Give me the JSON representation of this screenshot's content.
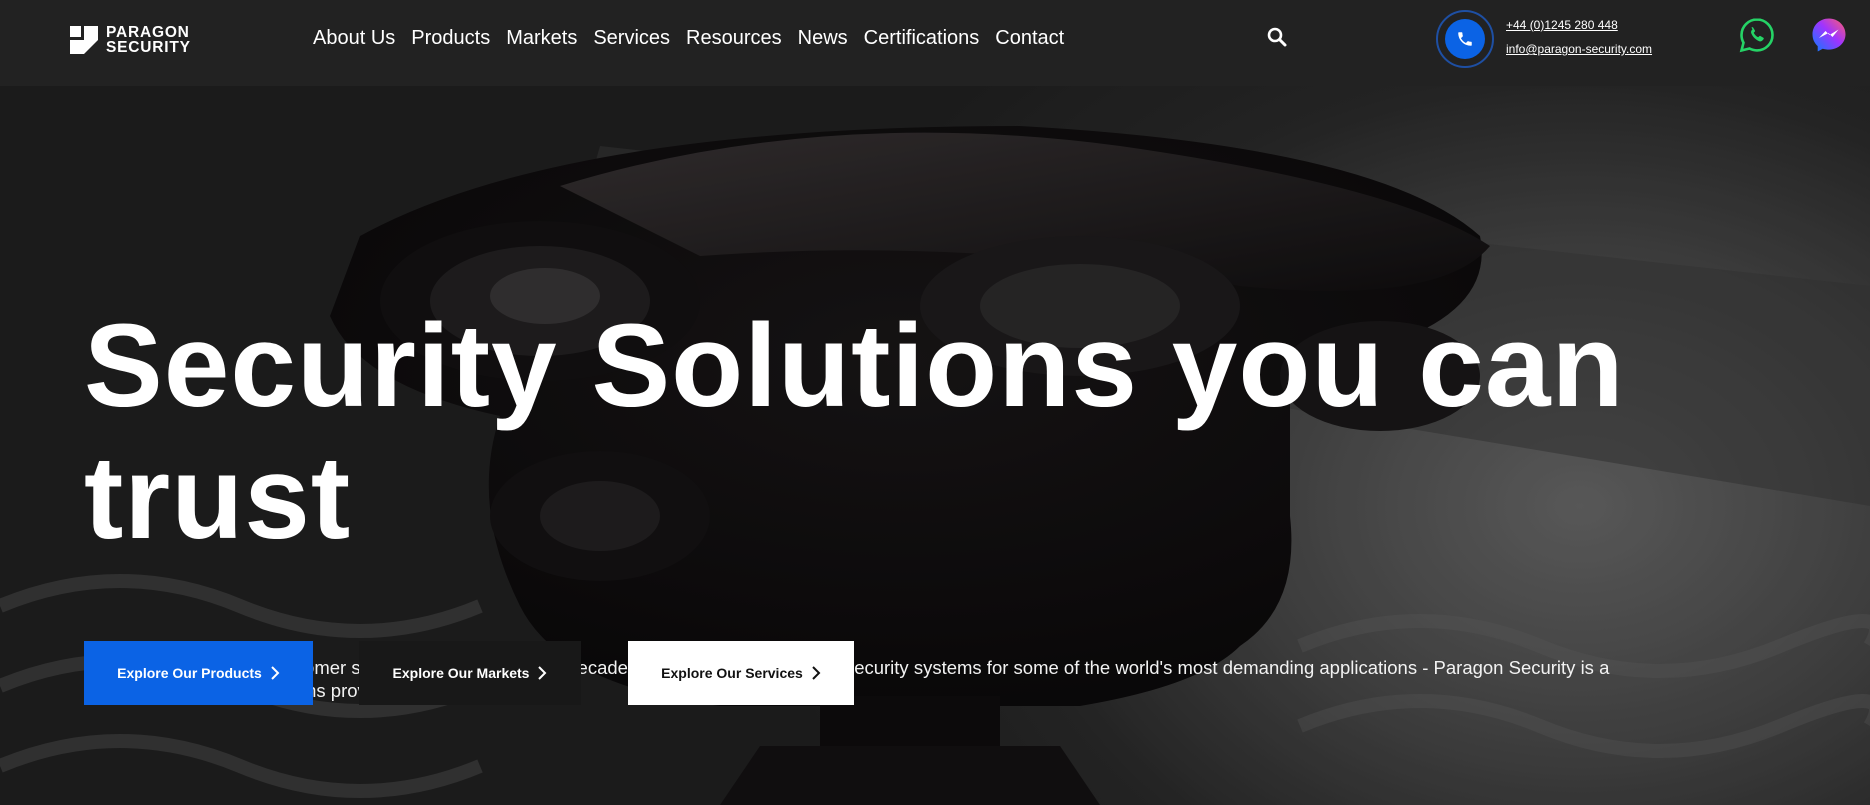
{
  "brand": {
    "line1": "PARAGON",
    "line2": "SECURITY"
  },
  "nav": {
    "items": [
      {
        "label": "About Us"
      },
      {
        "label": "Products"
      },
      {
        "label": "Markets"
      },
      {
        "label": "Services"
      },
      {
        "label": "Resources"
      },
      {
        "label": "News"
      },
      {
        "label": "Certifications"
      },
      {
        "label": "Contact"
      }
    ]
  },
  "contact": {
    "phone": "+44 (0)1245 280 448",
    "email": "info@paragon-security.com"
  },
  "hero": {
    "headline_line1": "Security Solutions you can",
    "headline_line2": "trust",
    "intro": "Founded on first class customer service and support - with decades of experience in fire and security systems for some of the world's most demanding applications - Paragon Security is a UK-based specialist solutions provider you can trust.",
    "buttons": {
      "products": "Explore Our Products",
      "markets": "Explore Our Markets",
      "services": "Explore Our Services"
    }
  },
  "colors": {
    "accent": "#0b63e5",
    "header_bg": "#222222",
    "whatsapp": "#25d366",
    "messenger_from": "#0a7cff",
    "messenger_to": "#ff5f6d"
  },
  "icons": [
    "logo-mark-icon",
    "search-icon",
    "phone-icon",
    "whatsapp-icon",
    "messenger-icon",
    "chevron-right-icon"
  ]
}
